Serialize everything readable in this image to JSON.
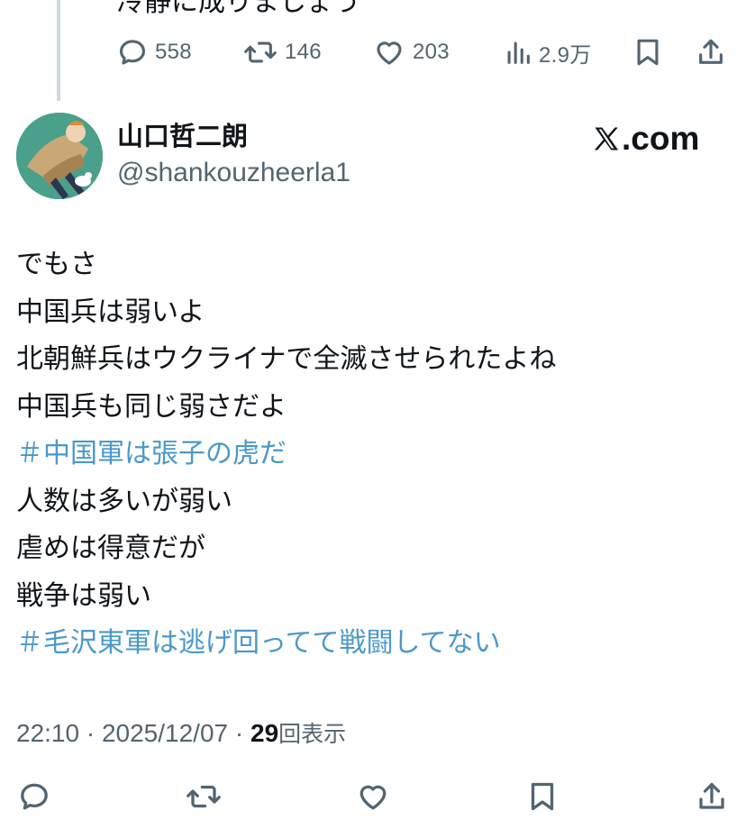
{
  "previous_tweet": {
    "text_fragment": "冷静に成りましょう",
    "actions": {
      "replies": "558",
      "reposts": "146",
      "likes": "203",
      "views": "2.9万"
    }
  },
  "tweet": {
    "author": {
      "display_name": "山口哲二朗",
      "handle": "@shankouzheerla1"
    },
    "brand": "X.com",
    "lines": [
      {
        "text": "でもさ",
        "type": "text"
      },
      {
        "text": "中国兵は弱いよ",
        "type": "text"
      },
      {
        "text": "北朝鮮兵はウクライナで全滅させられたよね",
        "type": "text"
      },
      {
        "text": "中国兵も同じ弱さだよ",
        "type": "text"
      },
      {
        "text": "＃中国軍は張子の虎だ",
        "type": "hashtag"
      },
      {
        "text": "人数は多いが弱い",
        "type": "text"
      },
      {
        "text": "虐めは得意だが",
        "type": "text"
      },
      {
        "text": "戦争は弱い",
        "type": "text"
      },
      {
        "text": "＃毛沢東軍は逃げ回ってて戦闘してない",
        "type": "hashtag"
      }
    ],
    "meta": {
      "time": "22:10",
      "date": "2025/12/07",
      "separator": " · ",
      "views_count": "29",
      "views_label": "回表示"
    }
  },
  "icons": {
    "reply": "reply-icon",
    "repost": "repost-icon",
    "like": "heart-icon",
    "views": "analytics-icon",
    "bookmark": "bookmark-icon",
    "share": "share-icon"
  },
  "colors": {
    "text": "#0f1419",
    "secondary": "#536471",
    "hashtag": "#4a99c9",
    "thread_line": "#cfd9de"
  }
}
